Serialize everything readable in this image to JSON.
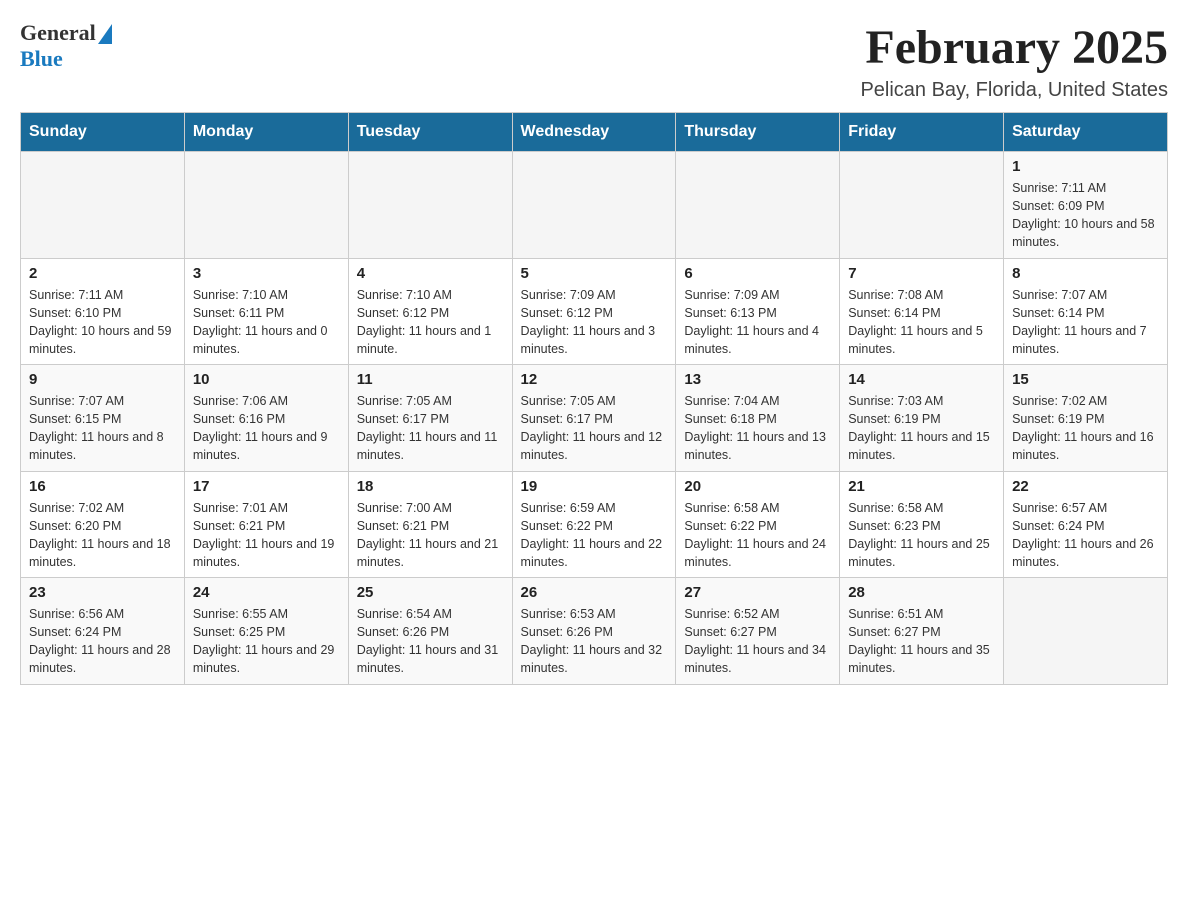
{
  "header": {
    "logo_general": "General",
    "logo_blue": "Blue",
    "month_title": "February 2025",
    "location": "Pelican Bay, Florida, United States"
  },
  "days_of_week": [
    "Sunday",
    "Monday",
    "Tuesday",
    "Wednesday",
    "Thursday",
    "Friday",
    "Saturday"
  ],
  "weeks": [
    [
      {
        "day": "",
        "info": ""
      },
      {
        "day": "",
        "info": ""
      },
      {
        "day": "",
        "info": ""
      },
      {
        "day": "",
        "info": ""
      },
      {
        "day": "",
        "info": ""
      },
      {
        "day": "",
        "info": ""
      },
      {
        "day": "1",
        "info": "Sunrise: 7:11 AM\nSunset: 6:09 PM\nDaylight: 10 hours and 58 minutes."
      }
    ],
    [
      {
        "day": "2",
        "info": "Sunrise: 7:11 AM\nSunset: 6:10 PM\nDaylight: 10 hours and 59 minutes."
      },
      {
        "day": "3",
        "info": "Sunrise: 7:10 AM\nSunset: 6:11 PM\nDaylight: 11 hours and 0 minutes."
      },
      {
        "day": "4",
        "info": "Sunrise: 7:10 AM\nSunset: 6:12 PM\nDaylight: 11 hours and 1 minute."
      },
      {
        "day": "5",
        "info": "Sunrise: 7:09 AM\nSunset: 6:12 PM\nDaylight: 11 hours and 3 minutes."
      },
      {
        "day": "6",
        "info": "Sunrise: 7:09 AM\nSunset: 6:13 PM\nDaylight: 11 hours and 4 minutes."
      },
      {
        "day": "7",
        "info": "Sunrise: 7:08 AM\nSunset: 6:14 PM\nDaylight: 11 hours and 5 minutes."
      },
      {
        "day": "8",
        "info": "Sunrise: 7:07 AM\nSunset: 6:14 PM\nDaylight: 11 hours and 7 minutes."
      }
    ],
    [
      {
        "day": "9",
        "info": "Sunrise: 7:07 AM\nSunset: 6:15 PM\nDaylight: 11 hours and 8 minutes."
      },
      {
        "day": "10",
        "info": "Sunrise: 7:06 AM\nSunset: 6:16 PM\nDaylight: 11 hours and 9 minutes."
      },
      {
        "day": "11",
        "info": "Sunrise: 7:05 AM\nSunset: 6:17 PM\nDaylight: 11 hours and 11 minutes."
      },
      {
        "day": "12",
        "info": "Sunrise: 7:05 AM\nSunset: 6:17 PM\nDaylight: 11 hours and 12 minutes."
      },
      {
        "day": "13",
        "info": "Sunrise: 7:04 AM\nSunset: 6:18 PM\nDaylight: 11 hours and 13 minutes."
      },
      {
        "day": "14",
        "info": "Sunrise: 7:03 AM\nSunset: 6:19 PM\nDaylight: 11 hours and 15 minutes."
      },
      {
        "day": "15",
        "info": "Sunrise: 7:02 AM\nSunset: 6:19 PM\nDaylight: 11 hours and 16 minutes."
      }
    ],
    [
      {
        "day": "16",
        "info": "Sunrise: 7:02 AM\nSunset: 6:20 PM\nDaylight: 11 hours and 18 minutes."
      },
      {
        "day": "17",
        "info": "Sunrise: 7:01 AM\nSunset: 6:21 PM\nDaylight: 11 hours and 19 minutes."
      },
      {
        "day": "18",
        "info": "Sunrise: 7:00 AM\nSunset: 6:21 PM\nDaylight: 11 hours and 21 minutes."
      },
      {
        "day": "19",
        "info": "Sunrise: 6:59 AM\nSunset: 6:22 PM\nDaylight: 11 hours and 22 minutes."
      },
      {
        "day": "20",
        "info": "Sunrise: 6:58 AM\nSunset: 6:22 PM\nDaylight: 11 hours and 24 minutes."
      },
      {
        "day": "21",
        "info": "Sunrise: 6:58 AM\nSunset: 6:23 PM\nDaylight: 11 hours and 25 minutes."
      },
      {
        "day": "22",
        "info": "Sunrise: 6:57 AM\nSunset: 6:24 PM\nDaylight: 11 hours and 26 minutes."
      }
    ],
    [
      {
        "day": "23",
        "info": "Sunrise: 6:56 AM\nSunset: 6:24 PM\nDaylight: 11 hours and 28 minutes."
      },
      {
        "day": "24",
        "info": "Sunrise: 6:55 AM\nSunset: 6:25 PM\nDaylight: 11 hours and 29 minutes."
      },
      {
        "day": "25",
        "info": "Sunrise: 6:54 AM\nSunset: 6:26 PM\nDaylight: 11 hours and 31 minutes."
      },
      {
        "day": "26",
        "info": "Sunrise: 6:53 AM\nSunset: 6:26 PM\nDaylight: 11 hours and 32 minutes."
      },
      {
        "day": "27",
        "info": "Sunrise: 6:52 AM\nSunset: 6:27 PM\nDaylight: 11 hours and 34 minutes."
      },
      {
        "day": "28",
        "info": "Sunrise: 6:51 AM\nSunset: 6:27 PM\nDaylight: 11 hours and 35 minutes."
      },
      {
        "day": "",
        "info": ""
      }
    ]
  ]
}
